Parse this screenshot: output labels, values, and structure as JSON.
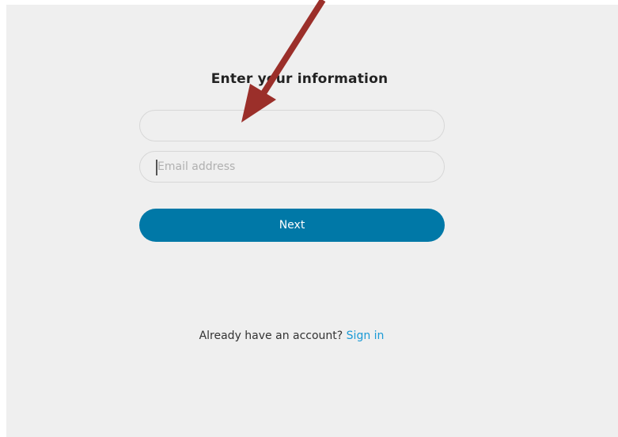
{
  "form": {
    "title": "Enter your information",
    "name_field": {
      "value": "",
      "placeholder": ""
    },
    "email_field": {
      "value": "",
      "placeholder": "Email address"
    },
    "next_label": "Next"
  },
  "footer": {
    "prompt": "Already have an account?",
    "signin_label": "Sign in"
  },
  "annotation": {
    "arrow_color": "#9b2f2a"
  },
  "colors": {
    "background": "#efefef",
    "accent": "#0078a7",
    "link": "#1a9ad6"
  }
}
